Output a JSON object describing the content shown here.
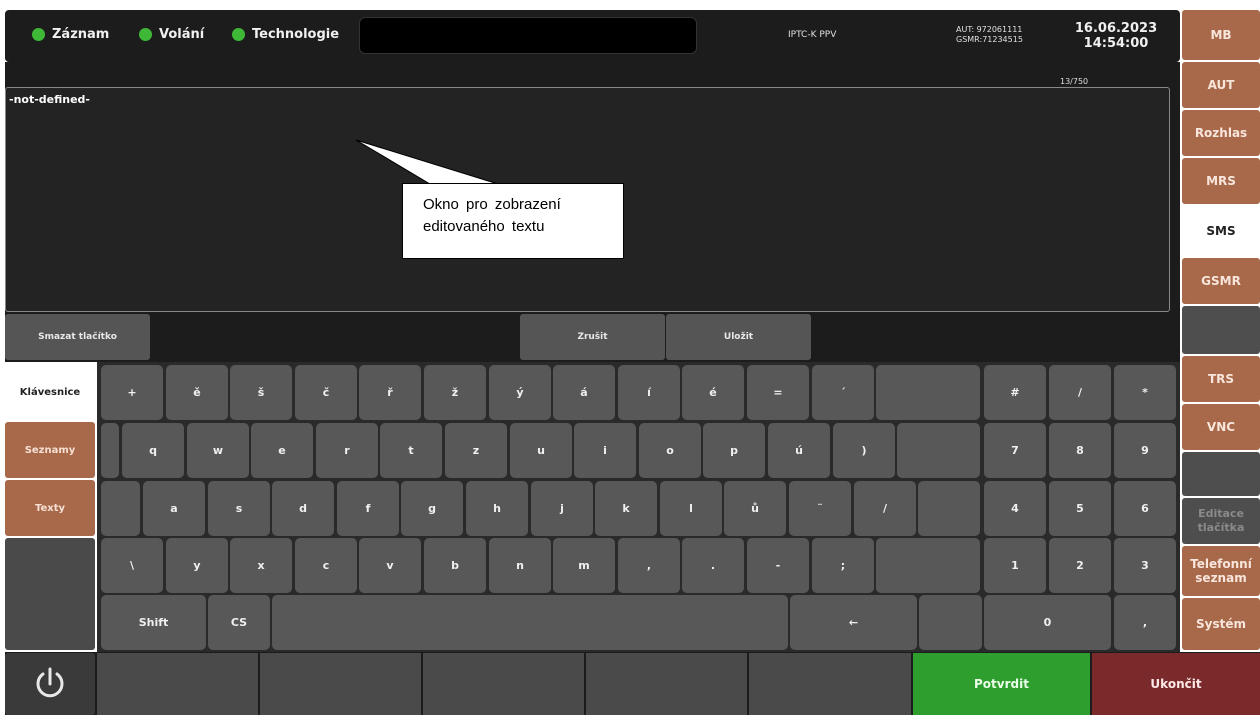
{
  "status_bar": {
    "indicators": [
      {
        "label": "Záznam",
        "color": "#3fb838"
      },
      {
        "label": "Volání",
        "color": "#3fb838"
      },
      {
        "label": "Technologie",
        "color": "#3fb838"
      }
    ],
    "connection": "IPTC-K PPV",
    "aut_id": "AUT: 972061111",
    "gsmr_id": "GSMR:71234515",
    "date": "16.06.2023",
    "time": "14:54:00"
  },
  "editor": {
    "counter": "13/750",
    "text": "-not-defined-"
  },
  "annotation": {
    "line1": "Okno pro zobrazení",
    "line2": "editovaného textu"
  },
  "actions": {
    "delete_label": "Smazat tlačítko",
    "cancel_label": "Zrušit",
    "save_label": "Uložit"
  },
  "left_tabs": {
    "keyboard": "Klávesnice",
    "lists": "Seznamy",
    "texts": "Texty"
  },
  "keyboard": {
    "row1": [
      "+",
      "ě",
      "š",
      "č",
      "ř",
      "ž",
      "ý",
      "á",
      "í",
      "é",
      "=",
      "´"
    ],
    "row2": [
      "q",
      "w",
      "e",
      "r",
      "t",
      "z",
      "u",
      "i",
      "o",
      "p",
      "ú",
      ")"
    ],
    "row3": [
      "a",
      "s",
      "d",
      "f",
      "g",
      "h",
      "j",
      "k",
      "l",
      "ů",
      "¨",
      "/"
    ],
    "row4": [
      "\\",
      "y",
      "x",
      "c",
      "v",
      "b",
      "n",
      "m",
      ",",
      ".",
      "-",
      ";"
    ],
    "shift": "Shift",
    "cs": "CS",
    "backspace": "←",
    "numpad": [
      [
        "#",
        "/",
        "*"
      ],
      [
        "7",
        "8",
        "9"
      ],
      [
        "4",
        "5",
        "6"
      ],
      [
        "1",
        "2",
        "3"
      ]
    ],
    "zero": "0",
    "decimal": ","
  },
  "bottom": {
    "confirm": "Potvrdit",
    "quit": "Ukončit"
  },
  "right_nav": {
    "mb": "MB",
    "aut": "AUT",
    "rozhlas": "Rozhlas",
    "mrs": "MRS",
    "sms": "SMS",
    "gsmr": "GSMR",
    "trs": "TRS",
    "vnc": "VNC",
    "edit_buttons_1": "Editace",
    "edit_buttons_2": "tlačítka",
    "phonebook_1": "Telefonní",
    "phonebook_2": "seznam",
    "system": "Systém"
  },
  "colors": {
    "indicator_green": "#3fb838",
    "nav_brown": "#a8684a",
    "confirm_green": "#2e9e2e",
    "quit_red": "#7a2a2a"
  }
}
